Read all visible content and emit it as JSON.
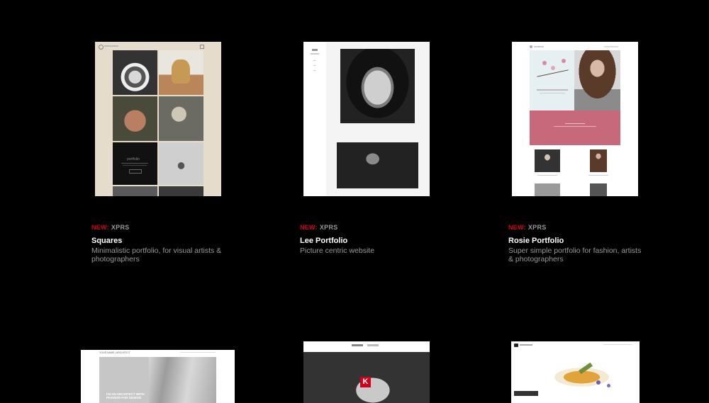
{
  "templates": [
    {
      "badge_new": "NEW:",
      "badge_product": "XPRS",
      "title": "Squares",
      "description": "Minimalistic portfolio, for visual artists & photographers",
      "preview_caption": "portfolio"
    },
    {
      "badge_new": "NEW:",
      "badge_product": "XPRS",
      "title": "Lee Portfolio",
      "description": "Picture centric website"
    },
    {
      "badge_new": "NEW:",
      "badge_product": "XPRS",
      "title": "Rosie Portfolio",
      "description": "Super simple portfolio for fashion, artists & photographers"
    },
    {
      "preview_header": "YOUR NAME | ARCHITECT",
      "preview_headline": "I'M AN ARCHITECT WITH PASSION FOR DESIGN"
    },
    {
      "preview_logo_letter": "K"
    },
    {}
  ],
  "colors": {
    "background": "#000000",
    "badge_new": "#d0021b",
    "badge_product": "#9a9a9a",
    "title": "#ffffff",
    "description": "#9a9a9a",
    "rosie_pink": "#c8697b",
    "squares_beige": "#e6dccb"
  }
}
